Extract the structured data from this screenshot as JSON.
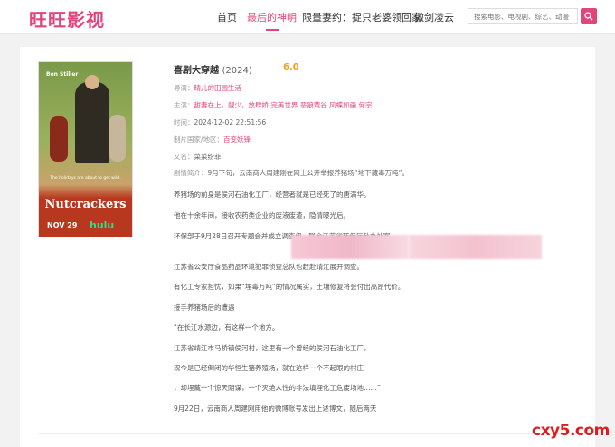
{
  "header": {
    "logo": "旺旺影视",
    "nav": [
      "首页",
      "最后的神明",
      "限量妻约：捉只老婆领回家",
      "傲剑凌云"
    ],
    "search_placeholder": "搜索电影、电视剧、综艺、动漫",
    "accent_color": "#e0457b"
  },
  "movie": {
    "title": "喜剧大穿越",
    "year": "(2024)",
    "score": "6.0",
    "director_label": "导演：",
    "director": "晴儿的田园生活",
    "cast_label": "主演：",
    "cast": "甜妻在上，靓少，放肆娇 完美世界 恶狼莺谷 风蝶如画 何宗",
    "time_label": "时间：",
    "time": "2024-12-02 22:51:56",
    "region_label": "制片国家/地区：",
    "region": "百变妖锋",
    "alias_label": "又名：",
    "alias": "菜菜纷菲",
    "synopsis_label": "剧情简介：",
    "synopsis": [
      "9月下旬，云南商人周建刚在网上公开举报养猪场“地下藏毒万吨”。",
      "养猪场的前身是侯河石油化工厂，经营者就是已经死了的唐满华。",
      "他在十余年间，接收农药类企业的废液废渣，隐情曝光后。",
      "环保部于9月28日召开专题会并成立调查组，联合江苏省环保厅赴办处案。",
      "江苏省公安厅食品药品环境犯罪侦查总队也赶赴靖江展开调查。",
      "有化工专家担忧，如果“埋毒万吨”的情况属实，土壤修复将会付出高昂代价。",
      "接手养猪场后的遭遇",
      "“在长江水源边，有这样一个地方。",
      "江苏省靖江市马桥镇侯河村，这里有一个曾经的侯河石油化工厂，",
      "现今是已经倒闭的华恒生猪养殖场，就在这样一个不起眼的村庄",
      "，却埋藏一个惊天阴谋，一个灭绝人性的非法填埋化工危废场地……”",
      "9月22日，云南商人周建刚用他的微博账号发出上述博文，随后两天"
    ]
  },
  "poster": {
    "actor": "Ben Stiller",
    "tagline": "The holidays are about to get wild.",
    "title": "Nutcrackers",
    "date": "NOV 29",
    "network": "hulu"
  },
  "watermark": "cxy5.com"
}
